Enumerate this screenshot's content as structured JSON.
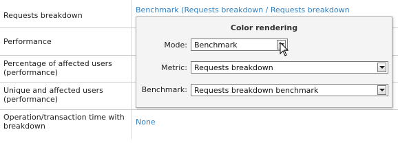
{
  "rows": [
    {
      "label": "Requests breakdown",
      "value": "Benchmark (Requests breakdown / Requests breakdown"
    },
    {
      "label": "Performance",
      "value": ""
    },
    {
      "label": "Percentage of affected users (performance)",
      "value": ""
    },
    {
      "label": "Unique and affected users (performance)",
      "value": ""
    },
    {
      "label": "Operation/transaction time with breakdown",
      "value": "None"
    }
  ],
  "popup": {
    "title": "Color rendering",
    "mode_label": "Mode:",
    "mode_value": "Benchmark",
    "metric_label": "Metric:",
    "metric_value": "Requests breakdown",
    "benchmark_label": "Benchmark:",
    "benchmark_value": "Requests breakdown benchmark"
  },
  "icons": {
    "dropdown": "chevron-down-icon",
    "cursor": "mouse-pointer-icon"
  },
  "colors": {
    "link": "#2f7fbf",
    "popup_bg": "#f4f4f4"
  }
}
